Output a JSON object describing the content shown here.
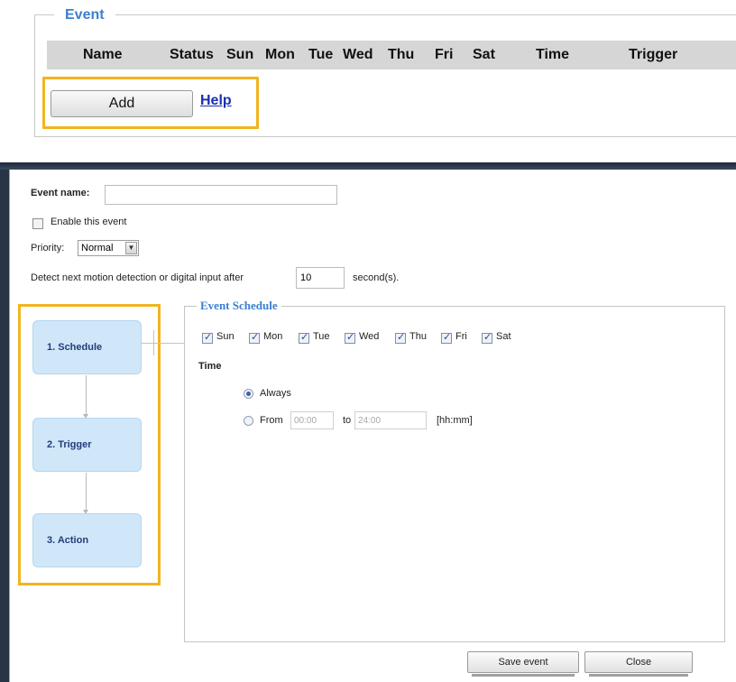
{
  "event_list": {
    "legend": "Event",
    "columns": [
      "Name",
      "Status",
      "Sun",
      "Mon",
      "Tue",
      "Wed",
      "Thu",
      "Fri",
      "Sat",
      "Time",
      "Trigger"
    ],
    "add_label": "Add",
    "help_label": "Help"
  },
  "dialog": {
    "event_name_label": "Event name:",
    "event_name_value": "",
    "enable_label": "Enable this event",
    "enable_checked": false,
    "priority_label": "Priority:",
    "priority_value": "Normal",
    "detect_label": "Detect next motion detection or digital input after",
    "detect_value": "10",
    "seconds_label": "second(s).",
    "steps": [
      {
        "label": "1. Schedule"
      },
      {
        "label": "2. Trigger"
      },
      {
        "label": "3. Action"
      }
    ],
    "schedule": {
      "legend": "Event Schedule",
      "days": [
        {
          "label": "Sun",
          "checked": true
        },
        {
          "label": "Mon",
          "checked": true
        },
        {
          "label": "Tue",
          "checked": true
        },
        {
          "label": "Wed",
          "checked": true
        },
        {
          "label": "Thu",
          "checked": true
        },
        {
          "label": "Fri",
          "checked": true
        },
        {
          "label": "Sat",
          "checked": true
        }
      ],
      "time_label": "Time",
      "always_label": "Always",
      "from_label": "From",
      "from_value": "00:00",
      "to_label": "to",
      "to_value": "24:00",
      "format_label": "[hh:mm]",
      "selected": "Always"
    },
    "save_label": "Save event",
    "close_label": "Close"
  }
}
